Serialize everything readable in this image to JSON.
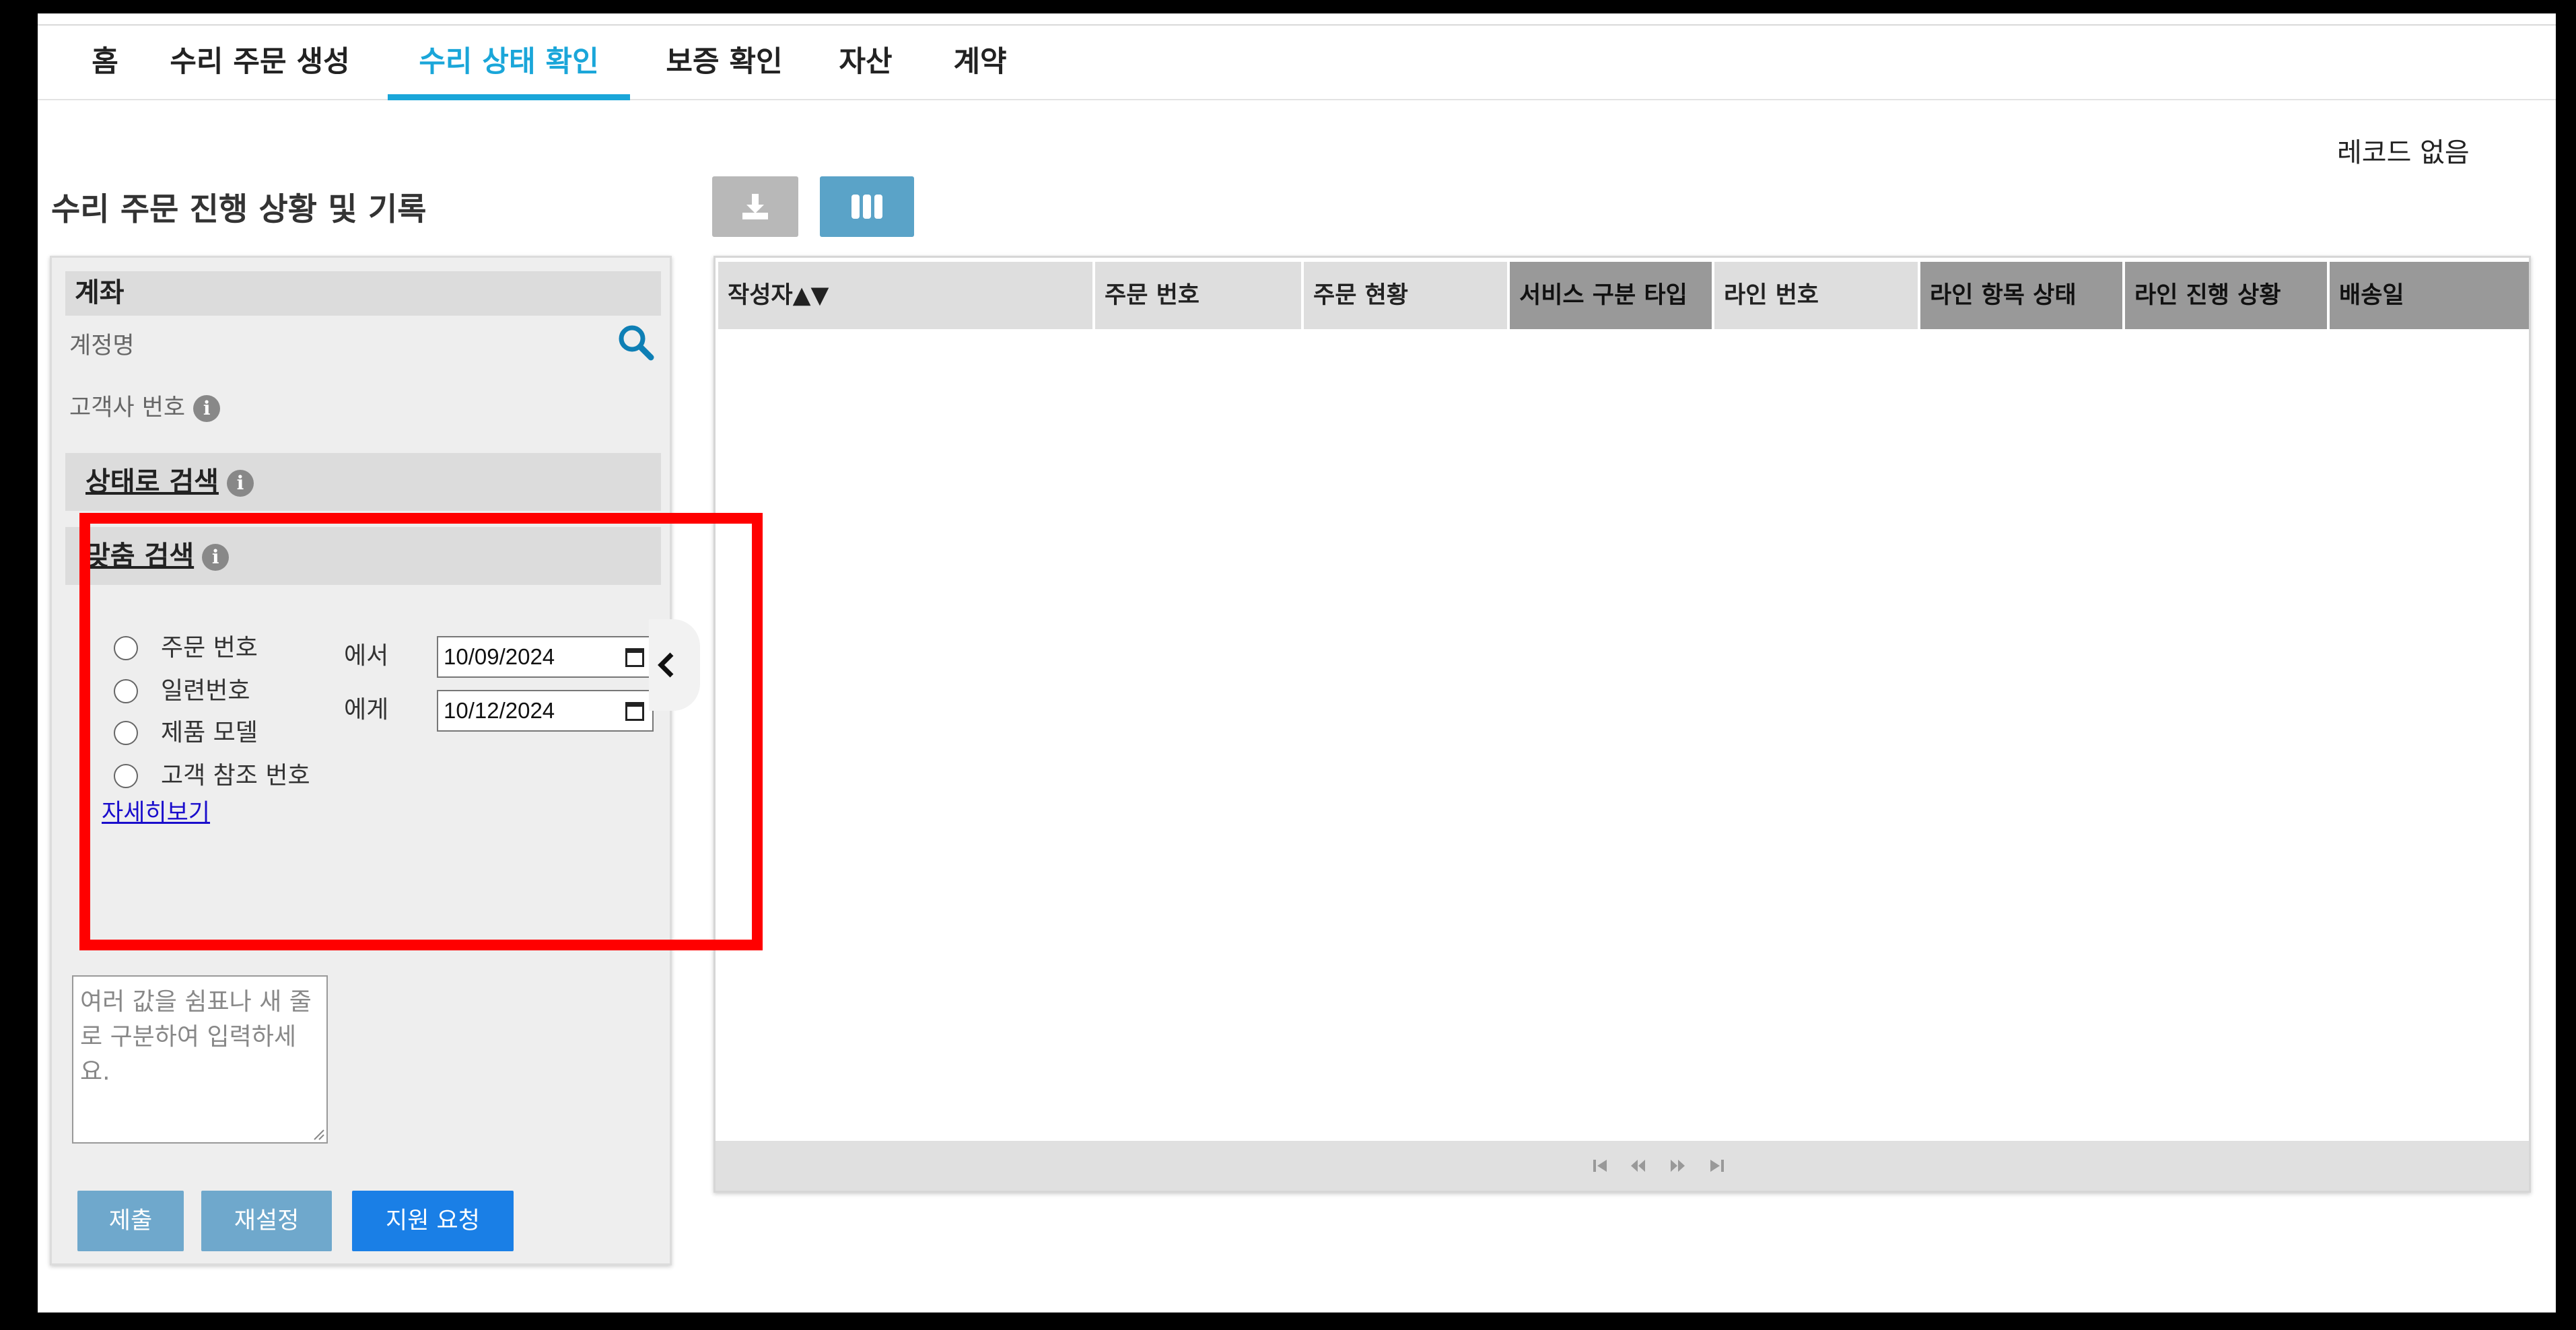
{
  "nav": {
    "tabs": [
      {
        "label": "홈"
      },
      {
        "label": "수리 주문 생성"
      },
      {
        "label": "수리 상태 확인",
        "active": true
      },
      {
        "label": "보증 확인"
      },
      {
        "label": "자산"
      },
      {
        "label": "계약"
      }
    ]
  },
  "header": {
    "records_text": "레코드 없음",
    "page_title": "수리 주문 진행 상황 및 기록"
  },
  "toolbar": {
    "download_icon": "download-icon",
    "columns_icon": "columns-icon",
    "download_color": "#b8b8b8",
    "columns_color": "#5aa3c8"
  },
  "left_panel": {
    "account_header": "계좌",
    "account_name_label": "계정명",
    "customer_number_label": "고객사 번호",
    "status_search_header": "상태로 검색",
    "custom_search_header": "맞춤 검색",
    "radio_options": [
      {
        "label": "주문 번호"
      },
      {
        "label": "일련번호"
      },
      {
        "label": "제품 모델"
      },
      {
        "label": "고객 참조 번호"
      }
    ],
    "from_label": "에서",
    "to_label": "에게",
    "from_date": "10/09/2024",
    "to_date": "10/12/2024",
    "more_link": "자세히보기",
    "textarea_placeholder": "여러 값을 쉼표나 새 줄로 구분하여 입력하세요.",
    "buttons": {
      "submit": "제출",
      "reset": "재설정",
      "support": "지원 요청"
    }
  },
  "grid": {
    "columns": [
      {
        "label": "작성자▲▼",
        "shade": "light"
      },
      {
        "label": "주문 번호",
        "shade": "light"
      },
      {
        "label": "주문 현황",
        "shade": "light"
      },
      {
        "label": "서비스 구분 타입",
        "shade": "dark"
      },
      {
        "label": "라인 번호",
        "shade": "light"
      },
      {
        "label": "라인 항목 상태",
        "shade": "dark"
      },
      {
        "label": "라인 진행 상황",
        "shade": "dark"
      },
      {
        "label": "배송일",
        "shade": "dark"
      }
    ],
    "rows": []
  },
  "colors": {
    "accent": "#1aa6d9",
    "highlight": "#ff0000",
    "primary_button": "#1a7fe6",
    "secondary_button": "#6fa8cc"
  }
}
